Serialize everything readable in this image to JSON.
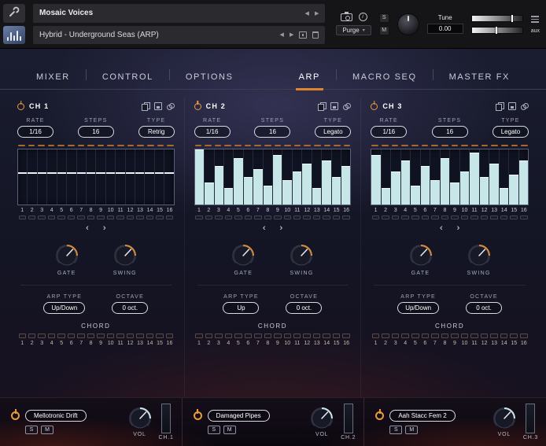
{
  "header": {
    "instrument_title": "Mosaic Voices",
    "snapshot_title": "Hybrid - Underground Seas (ARP)",
    "purge_label": "Purge",
    "tune_label": "Tune",
    "tune_value": "0.00",
    "solo_label": "S",
    "mute_label": "M",
    "aux_label": "aux",
    "nav_prev": "◀",
    "nav_next": "▶"
  },
  "ui": {
    "chevron_left": "‹",
    "chevron_right": "›",
    "caret_down": "▾"
  },
  "tabs": {
    "left": [
      "MIXER",
      "CONTROL",
      "OPTIONS"
    ],
    "right": [
      "ARP",
      "MACRO SEQ",
      "MASTER FX"
    ],
    "active": "ARP"
  },
  "step_numbers": [
    "1",
    "2",
    "3",
    "4",
    "5",
    "6",
    "7",
    "8",
    "9",
    "10",
    "11",
    "12",
    "13",
    "14",
    "15",
    "16"
  ],
  "channels": [
    {
      "name": "CH 1",
      "rate_label": "RATE",
      "rate": "1/16",
      "steps_label": "STEPS",
      "steps": "16",
      "type_label": "TYPE",
      "type": "Retrig",
      "gate_label": "GATE",
      "swing_label": "SWING",
      "arp_type_label": "ARP TYPE",
      "arp_type": "Up/Down",
      "octave_label": "OCTAVE",
      "octave": "0 oct.",
      "chord_label": "CHORD",
      "display": "line",
      "step_values": [
        0.58,
        0.58,
        0.58,
        0.58,
        0.58,
        0.58,
        0.58,
        0.58,
        0.58,
        0.58,
        0.58,
        0.58,
        0.58,
        0.58,
        0.58,
        0.58
      ]
    },
    {
      "name": "CH 2",
      "rate_label": "RATE",
      "rate": "1/16",
      "steps_label": "STEPS",
      "steps": "16",
      "type_label": "TYPE",
      "type": "Legato",
      "gate_label": "GATE",
      "swing_label": "SWING",
      "arp_type_label": "ARP TYPE",
      "arp_type": "Up",
      "octave_label": "OCTAVE",
      "octave": "0 oct.",
      "chord_label": "CHORD",
      "display": "bars",
      "step_values": [
        1.0,
        0.4,
        0.7,
        0.3,
        0.85,
        0.5,
        0.65,
        0.35,
        0.9,
        0.45,
        0.6,
        0.75,
        0.3,
        0.8,
        0.5,
        0.7
      ]
    },
    {
      "name": "CH 3",
      "rate_label": "RATE",
      "rate": "1/16",
      "steps_label": "STEPS",
      "steps": "16",
      "type_label": "TYPE",
      "type": "Legato",
      "gate_label": "GATE",
      "swing_label": "SWING",
      "arp_type_label": "ARP TYPE",
      "arp_type": "Up/Down",
      "octave_label": "OCTAVE",
      "octave": "0 oct.",
      "chord_label": "CHORD",
      "display": "bars",
      "step_values": [
        0.9,
        0.3,
        0.6,
        0.8,
        0.35,
        0.7,
        0.45,
        0.85,
        0.4,
        0.6,
        0.95,
        0.5,
        0.75,
        0.3,
        0.55,
        0.8
      ]
    }
  ],
  "mixer": [
    {
      "name": "Mellotronic Drift",
      "solo": "S",
      "mute": "M",
      "vol_label": "VOL",
      "ch_label": "CH.1"
    },
    {
      "name": "Damaged Pipes",
      "solo": "S",
      "mute": "M",
      "vol_label": "VOL",
      "ch_label": "CH.2"
    },
    {
      "name": "Aah Stacc Fem 2",
      "solo": "S",
      "mute": "M",
      "vol_label": "VOL",
      "ch_label": "CH.3"
    }
  ],
  "colors": {
    "accent_orange": "#d98a3a",
    "tab_underline": "#e0832e",
    "bar_fill": "#c6e6e8",
    "tick_orange": "#a9692e",
    "vol_knob_arc": "#cfe6ea"
  }
}
